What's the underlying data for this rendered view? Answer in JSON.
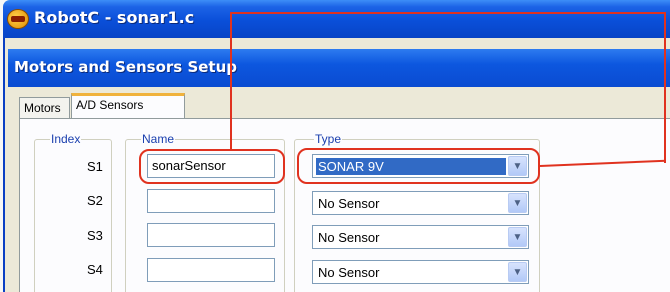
{
  "window": {
    "title": "RobotC - sonar1.c",
    "icon": "robotc-app-icon"
  },
  "dialog": {
    "title": "Motors and Sensors Setup"
  },
  "tabs": [
    {
      "label": "Motors",
      "active": false
    },
    {
      "label": "A/D Sensors",
      "active": true
    }
  ],
  "columns": {
    "index": "Index",
    "name": "Name",
    "type": "Type"
  },
  "sensors": [
    {
      "index": "S1",
      "name": "sonarSensor",
      "type": "SONAR 9V",
      "selected": true
    },
    {
      "index": "S2",
      "name": "",
      "type": "No Sensor",
      "selected": false
    },
    {
      "index": "S3",
      "name": "",
      "type": "No Sensor",
      "selected": false
    },
    {
      "index": "S4",
      "name": "",
      "type": "No Sensor",
      "selected": false
    }
  ],
  "colors": {
    "annotation": "#e0321f",
    "title_bar": "#0a4fd9",
    "selection": "#316ac5"
  }
}
